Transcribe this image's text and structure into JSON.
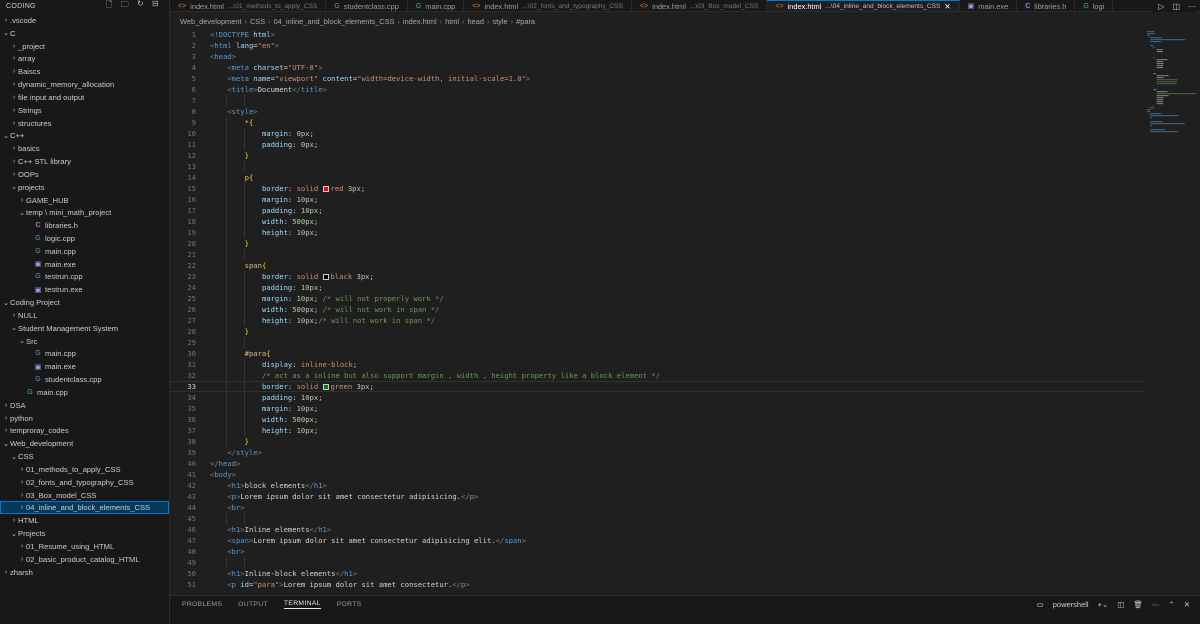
{
  "sidebar": {
    "title": "CODING",
    "tree": [
      {
        "label": ".vscode",
        "depth": 0,
        "kind": "folder",
        "open": false
      },
      {
        "label": "C",
        "depth": 0,
        "kind": "folder",
        "open": true
      },
      {
        "label": "_project",
        "depth": 1,
        "kind": "folder",
        "open": false
      },
      {
        "label": "array",
        "depth": 1,
        "kind": "folder",
        "open": false
      },
      {
        "label": "Baiscs",
        "depth": 1,
        "kind": "folder",
        "open": false
      },
      {
        "label": "dynamic_memory_allocation",
        "depth": 1,
        "kind": "folder",
        "open": false
      },
      {
        "label": "file input and output",
        "depth": 1,
        "kind": "folder",
        "open": false
      },
      {
        "label": "Strings",
        "depth": 1,
        "kind": "folder",
        "open": false
      },
      {
        "label": "structures",
        "depth": 1,
        "kind": "folder",
        "open": false
      },
      {
        "label": "C++",
        "depth": 0,
        "kind": "folder",
        "open": true
      },
      {
        "label": "basics",
        "depth": 1,
        "kind": "folder",
        "open": false
      },
      {
        "label": "C++ STL library",
        "depth": 1,
        "kind": "folder",
        "open": false
      },
      {
        "label": "OOPs",
        "depth": 1,
        "kind": "folder",
        "open": false
      },
      {
        "label": "projects",
        "depth": 1,
        "kind": "folder",
        "open": true
      },
      {
        "label": "GAME_HUB",
        "depth": 2,
        "kind": "folder",
        "open": false
      },
      {
        "label": "temp \\ mini_math_project",
        "depth": 2,
        "kind": "folder",
        "open": true
      },
      {
        "label": "libraries.h",
        "depth": 3,
        "kind": "c",
        "open": false
      },
      {
        "label": "logic.cpp",
        "depth": 3,
        "kind": "cpp",
        "open": false
      },
      {
        "label": "main.cpp",
        "depth": 3,
        "kind": "cpp",
        "open": false
      },
      {
        "label": "main.exe",
        "depth": 3,
        "kind": "exe",
        "open": false
      },
      {
        "label": "testrun.cpp",
        "depth": 3,
        "kind": "cpp",
        "open": false
      },
      {
        "label": "testrun.exe",
        "depth": 3,
        "kind": "exe",
        "open": false
      },
      {
        "label": "Coding Project",
        "depth": 0,
        "kind": "folder",
        "open": true
      },
      {
        "label": "NULL",
        "depth": 1,
        "kind": "folder",
        "open": false
      },
      {
        "label": "Student Management System",
        "depth": 1,
        "kind": "folder",
        "open": true
      },
      {
        "label": "Src",
        "depth": 2,
        "kind": "folder",
        "open": true
      },
      {
        "label": "main.cpp",
        "depth": 3,
        "kind": "cpp",
        "open": false
      },
      {
        "label": "main.exe",
        "depth": 3,
        "kind": "exe",
        "open": false
      },
      {
        "label": "studentclass.cpp",
        "depth": 3,
        "kind": "cpp",
        "open": false
      },
      {
        "label": "main.cpp",
        "depth": 2,
        "kind": "cpp",
        "open": false
      },
      {
        "label": "DSA",
        "depth": 0,
        "kind": "folder",
        "open": false
      },
      {
        "label": "python",
        "depth": 0,
        "kind": "folder",
        "open": false
      },
      {
        "label": "temproray_codes",
        "depth": 0,
        "kind": "folder",
        "open": false
      },
      {
        "label": "Web_development",
        "depth": 0,
        "kind": "folder",
        "open": true
      },
      {
        "label": "CSS",
        "depth": 1,
        "kind": "folder",
        "open": true
      },
      {
        "label": "01_methods_to_apply_CSS",
        "depth": 2,
        "kind": "folder",
        "open": false
      },
      {
        "label": "02_fonts_and_typography_CSS",
        "depth": 2,
        "kind": "folder",
        "open": false
      },
      {
        "label": "03_Box_model_CSS",
        "depth": 2,
        "kind": "folder",
        "open": false
      },
      {
        "label": "04_inline_and_block_elements_CSS",
        "depth": 2,
        "kind": "folder",
        "open": false,
        "selected": true
      },
      {
        "label": "HTML",
        "depth": 1,
        "kind": "folder",
        "open": false
      },
      {
        "label": "Projects",
        "depth": 1,
        "kind": "folder",
        "open": true
      },
      {
        "label": "01_Resume_using_HTML",
        "depth": 2,
        "kind": "folder",
        "open": false
      },
      {
        "label": "02_basic_product_catalog_HTML",
        "depth": 2,
        "kind": "folder",
        "open": false
      },
      {
        "label": "zharsh",
        "depth": 0,
        "kind": "folder",
        "open": false
      }
    ]
  },
  "tabs": [
    {
      "icon": "html-icon",
      "label": "index.html",
      "desc": "...\\01_methods_to_apply_CSS",
      "active": false
    },
    {
      "icon": "cpp-icon",
      "label": "studentclass.cpp",
      "desc": "",
      "active": false
    },
    {
      "icon": "cpp-icon",
      "label": "main.cpp",
      "desc": "",
      "active": false
    },
    {
      "icon": "html-icon",
      "label": "index.html",
      "desc": "...\\02_fonts_and_typography_CSS",
      "active": false
    },
    {
      "icon": "html-icon",
      "label": "index.html",
      "desc": "...\\03_Box_model_CSS",
      "active": false
    },
    {
      "icon": "html-icon",
      "label": "index.html",
      "desc": "...\\04_inline_and_block_elements_CSS",
      "active": true
    },
    {
      "icon": "exe-icon",
      "label": "main.exe",
      "desc": "",
      "active": false
    },
    {
      "icon": "c-icon",
      "label": "libraries.h",
      "desc": "",
      "active": false
    },
    {
      "icon": "cpp-icon",
      "label": "logi",
      "desc": "",
      "active": false
    }
  ],
  "breadcrumbs": [
    "Web_development",
    "CSS",
    "04_inline_and_block_elements_CSS",
    "index.html",
    "html",
    "head",
    "style",
    "#para"
  ],
  "editor": {
    "current_line": 33,
    "first_line": 1,
    "lines": [
      "<!DOCTYPE html>",
      "<html lang=\"en\">",
      "<head>",
      "    <meta charset=\"UTF-8\">",
      "    <meta name=\"viewport\" content=\"width=device-width, initial-scale=1.0\">",
      "    <title>Document</title>",
      "",
      "    <style>",
      "        *{",
      "            margin: 0px;",
      "            padding: 0px;",
      "        }",
      "",
      "        p{",
      "            border: solid red 3px;",
      "            margin: 10px;",
      "            padding: 10px;",
      "            width: 500px;",
      "            height: 10px;",
      "        }",
      "",
      "        span{",
      "            border: solid black 3px;",
      "            padding: 10px;",
      "            margin: 10px; /* will not properly work */",
      "            width: 500px; /* will not work in span */",
      "            height: 10px;/* will not work in span */",
      "        }",
      "",
      "        #para{",
      "            display: inline-block;",
      "            /* act as a inline but also support margin , width , height property like a block element */",
      "            border: solid green 3px;",
      "            padding: 10px;",
      "            margin: 10px;",
      "            width: 500px;",
      "            height: 10px;",
      "        }",
      "    </style>",
      "</head>",
      "<body>",
      "    <h1>block elements</h1>",
      "    <p>Lorem ipsum dolor sit amet consectetur adipisicing.</p>",
      "    <br>",
      "",
      "    <h1>Inline elements</h1>",
      "    <span>Lorem ipsum dolor sit amet consectetur adipisicing elit.</span>",
      "    <br>",
      "",
      "    <h1>Inline-block elements</h1>",
      "    <p id=\"para\">Lorem ipsum dolor sit amet consectetur.</p>"
    ]
  },
  "colors": {
    "accent": "#0078d4",
    "swatch_red": "#ff0000",
    "swatch_black": "#000000",
    "swatch_green": "#008000"
  },
  "panel": {
    "tabs": [
      "PROBLEMS",
      "OUTPUT",
      "TERMINAL",
      "PORTS"
    ],
    "active_tab": "TERMINAL",
    "terminal_name": "powershell"
  }
}
